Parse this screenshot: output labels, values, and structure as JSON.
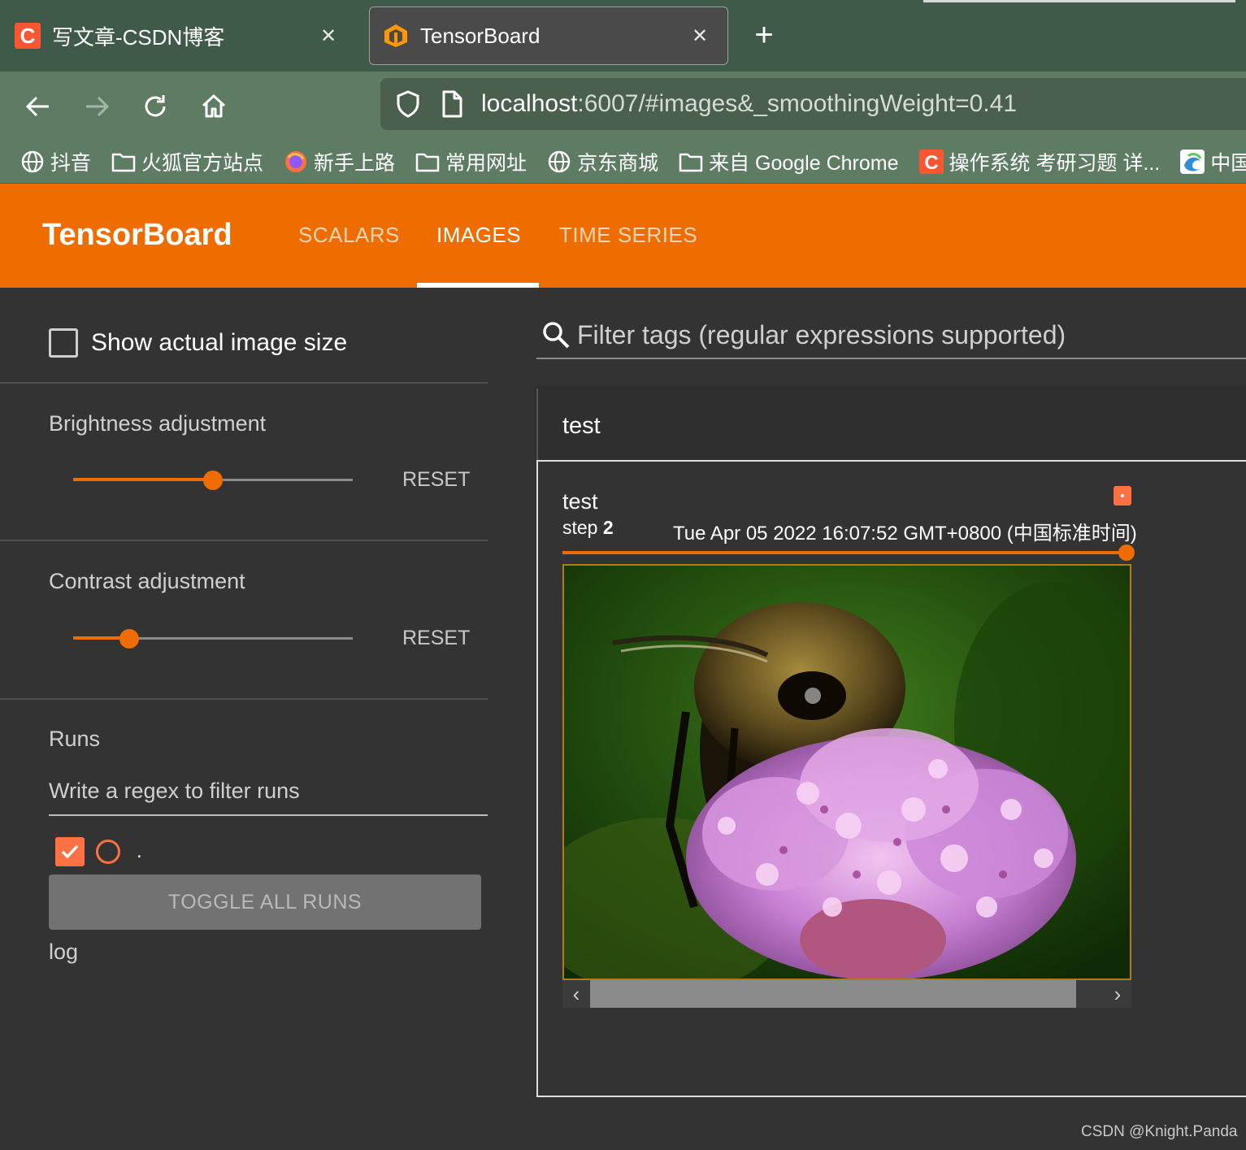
{
  "browser": {
    "tabs": [
      {
        "title": "写文章-CSDN博客",
        "favicon": "csdn-icon",
        "active": false
      },
      {
        "title": "TensorBoard",
        "favicon": "tensorboard-icon",
        "active": true
      }
    ],
    "url_host": "localhost",
    "url_rest": ":6007/#images&_smoothingWeight=0.41",
    "bookmarks": [
      {
        "label": "抖音",
        "icon": "globe-icon"
      },
      {
        "label": "火狐官方站点",
        "icon": "folder-icon"
      },
      {
        "label": "新手上路",
        "icon": "firefox-icon"
      },
      {
        "label": "常用网址",
        "icon": "folder-icon"
      },
      {
        "label": "京东商城",
        "icon": "globe-icon"
      },
      {
        "label": "来自 Google Chrome",
        "icon": "folder-icon"
      },
      {
        "label": "操作系统 考研习题 详...",
        "icon": "csdn-icon"
      },
      {
        "label": "中国",
        "icon": "edge-icon"
      }
    ]
  },
  "tensorboard": {
    "brand": "TensorBoard",
    "tabs": {
      "scalars": "SCALARS",
      "images": "IMAGES",
      "time_series": "TIME SERIES"
    },
    "active_tab": "IMAGES",
    "accent_color": "#ef6c00"
  },
  "sidebar": {
    "show_actual_size_label": "Show actual image size",
    "show_actual_size_checked": false,
    "brightness": {
      "label": "Brightness adjustment",
      "reset_label": "RESET",
      "value_fraction": 0.5
    },
    "contrast": {
      "label": "Contrast adjustment",
      "reset_label": "RESET",
      "value_fraction": 0.2
    },
    "runs": {
      "title": "Runs",
      "filter_placeholder": "Write a regex to filter runs",
      "items": [
        {
          "name": ".",
          "checked": true,
          "color": "#ff7043"
        }
      ],
      "toggle_all_label": "TOGGLE ALL RUNS",
      "logdir": "log"
    }
  },
  "main": {
    "filter_placeholder": "Filter tags (regular expressions supported)",
    "group_title": "test",
    "card": {
      "tag": "test",
      "step_label": "step",
      "step_value": "2",
      "timestamp": "Tue Apr 05 2022 16:07:52 GMT+0800 (中国标准时间)",
      "step_slider_fraction": 1.0,
      "image_description_icon": "bee-on-flower-image"
    }
  },
  "watermark": "CSDN @Knight.Panda"
}
